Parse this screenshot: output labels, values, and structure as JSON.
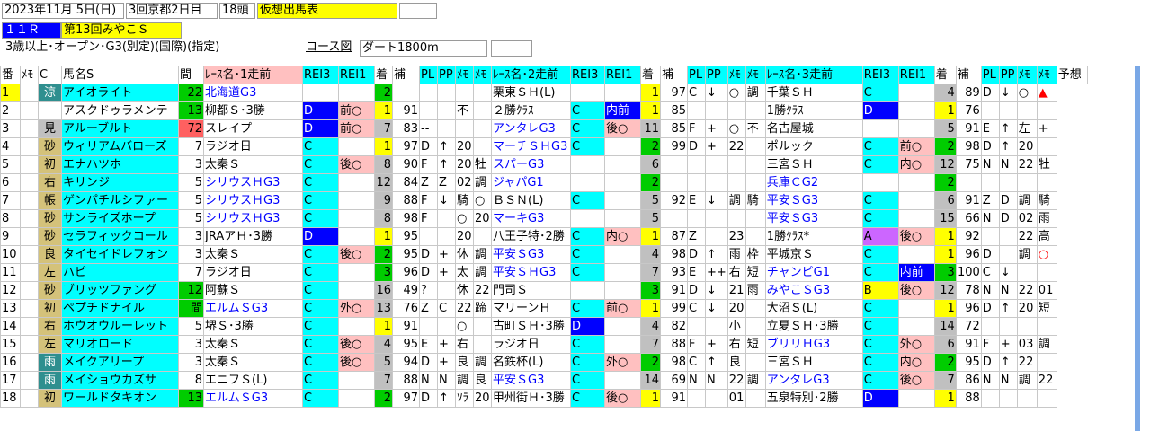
{
  "header": {
    "date": "2023年11月  5日(日)",
    "meeting": "3回京都2日目",
    "runners": "18頭",
    "sheet_title": "仮想出馬表",
    "race_no": "１１Ｒ",
    "race_name": "第13回みやこＳ",
    "conditions": "3歳以上･オープン･G3(別定)(国際)(指定)",
    "course_label": "コース図",
    "course": "ダート1800m"
  },
  "colors": {
    "yellow": "#ffff00",
    "cyan": "#00ffff",
    "blue": "#0000ff",
    "pink": "#ffc0c0",
    "gray": "#c0c0c0",
    "green": "#00cc00",
    "red_number": "#ff6060",
    "badge_gold": "#d4c27a",
    "badge_teal": "#2f8f8f",
    "text_blue": "#0000ff",
    "text_red": "#ff0000",
    "a_purple": "#cc66ff"
  },
  "columns": [
    "番",
    "ﾒﾓ",
    "C",
    "馬名S",
    "間",
    "ﾚｰｽ名･1走前",
    "REI3",
    "REI1",
    "着",
    "補",
    "PL",
    "PP",
    "ﾒﾓ",
    "ﾒﾓ",
    "ﾚｰｽ名･2走前",
    "REI3",
    "REI1",
    "着",
    "補",
    "PL",
    "PP",
    "ﾒﾓ",
    "ﾒﾓ",
    "ﾚｰｽ名･3走前",
    "REI3",
    "REI1",
    "着",
    "補",
    "PL",
    "PP",
    "ﾒﾓ",
    "ﾒﾓ",
    "予想"
  ],
  "rows": [
    [
      "1",
      "",
      "涼",
      "アイオライト",
      "22",
      "北海道G3",
      "",
      "",
      "2",
      "",
      "",
      "",
      "",
      "",
      "栗東ＳＨ(L)",
      "",
      "",
      "1",
      "97",
      "C",
      "↓",
      "○",
      "調",
      "千葉ＳＨ",
      "C",
      "",
      "4",
      "89",
      "D",
      "↓",
      "○",
      "▲"
    ],
    [
      "2",
      "",
      "",
      "アスクドゥラメンテ",
      "13",
      "柳都Ｓ･3勝",
      "D",
      "前○",
      "1",
      "91",
      "",
      "",
      "不",
      "",
      "２勝ｸﾗｽ",
      "C",
      "内前",
      "1",
      "85",
      "",
      "",
      "",
      "",
      "1勝ｸﾗｽ",
      "D",
      "",
      "1",
      "76",
      "",
      "",
      "",
      ""
    ],
    [
      "3",
      "",
      "見",
      "アルーブルト",
      "72",
      "スレイプ",
      "D",
      "前○",
      "7",
      "83",
      "--",
      "",
      "",
      "",
      "アンタレG3",
      "C",
      "後○",
      "11",
      "85",
      "F",
      "+",
      "○",
      "不",
      "名古屋城",
      "",
      "",
      "5",
      "91",
      "E",
      "↑",
      "左",
      "+"
    ],
    [
      "4",
      "",
      "砂",
      "ウィリアムバローズ",
      "7",
      "ラジオ日",
      "C",
      "",
      "1",
      "97",
      "D",
      "↑",
      "20",
      "",
      "マーチＳＨG3",
      "C",
      "",
      "2",
      "99",
      "D",
      "+",
      "22",
      "",
      "ポルック",
      "C",
      "前○",
      "2",
      "98",
      "D",
      "↑",
      "20",
      ""
    ],
    [
      "5",
      "",
      "初",
      "エナハツホ",
      "3",
      "太秦Ｓ",
      "C",
      "後○",
      "8",
      "90",
      "F",
      "↑",
      "20",
      "牡",
      "スパーG3",
      "",
      "",
      "6",
      "",
      "",
      "",
      "",
      "",
      "三宮ＳＨ",
      "C",
      "内○",
      "12",
      "75",
      "N",
      "N",
      "22",
      "牡"
    ],
    [
      "6",
      "",
      "右",
      "キリンジ",
      "5",
      "シリウスＨG3",
      "C",
      "",
      "12",
      "84",
      "Z",
      "Z",
      "02",
      "調",
      "ジャパG1",
      "",
      "",
      "2",
      "",
      "",
      "",
      "",
      "",
      "兵庫ＣG2",
      "",
      "",
      "2",
      "",
      "",
      "",
      "",
      ""
    ],
    [
      "7",
      "",
      "帳",
      "ゲンパチルシファー",
      "5",
      "シリウスＨG3",
      "C",
      "",
      "9",
      "88",
      "F",
      "↓",
      "騎",
      "○",
      "ＢＳＮ(L)",
      "C",
      "",
      "5",
      "92",
      "E",
      "↓",
      "調",
      "騎",
      "平安ＳG3",
      "C",
      "",
      "6",
      "91",
      "Z",
      "D",
      "調",
      "騎"
    ],
    [
      "8",
      "",
      "砂",
      "サンライズホープ",
      "5",
      "シリウスＨG3",
      "C",
      "",
      "8",
      "98",
      "F",
      "",
      "○",
      "20",
      "マーキG3",
      "",
      "",
      "5",
      "",
      "",
      "",
      "",
      "",
      "平安ＳG3",
      "C",
      "",
      "15",
      "66",
      "N",
      "D",
      "02",
      "雨"
    ],
    [
      "9",
      "",
      "砂",
      "セラフィックコール",
      "3",
      "JRAアＨ･3勝",
      "D",
      "",
      "1",
      "95",
      "",
      "",
      "20",
      "",
      "八王子特･2勝",
      "C",
      "内○",
      "1",
      "87",
      "Z",
      "",
      "23",
      "",
      "1勝ｸﾗｽ*",
      "A",
      "後○",
      "1",
      "92",
      "",
      "",
      "22",
      "高"
    ],
    [
      "10",
      "",
      "良",
      "タイセイドレフォン",
      "3",
      "太秦Ｓ",
      "C",
      "後○",
      "2",
      "95",
      "D",
      "+",
      "休",
      "調",
      "平安ＳG3",
      "C",
      "",
      "4",
      "98",
      "D",
      "↑",
      "雨",
      "枠",
      "平城京Ｓ",
      "C",
      "",
      "1",
      "96",
      "D",
      "",
      "調",
      "○"
    ],
    [
      "11",
      "",
      "左",
      "ハピ",
      "7",
      "ラジオ日",
      "C",
      "",
      "3",
      "96",
      "D",
      "+",
      "太",
      "調",
      "平安ＳＨG3",
      "C",
      "",
      "7",
      "93",
      "E",
      "++",
      "右",
      "短",
      "チャンピG1",
      "C",
      "内前",
      "3",
      "100",
      "C",
      "↓",
      "",
      ""
    ],
    [
      "12",
      "",
      "砂",
      "ブリッツファング",
      "12",
      "阿蘇Ｓ",
      "C",
      "",
      "16",
      "49",
      "?",
      "",
      "休",
      "22",
      "門司Ｓ",
      "",
      "",
      "3",
      "91",
      "D",
      "↓",
      "21",
      "雨",
      "みやこＳG3",
      "B",
      "後○",
      "12",
      "78",
      "N",
      "N",
      "22",
      "01"
    ],
    [
      "13",
      "",
      "初",
      "ペプチドナイル",
      "間",
      "エルムＳG3",
      "C",
      "外○",
      "13",
      "76",
      "Z",
      "C",
      "22",
      "蹄",
      "マリーンＨ",
      "C",
      "前○",
      "1",
      "99",
      "C",
      "↓",
      "20",
      "",
      "大沼Ｓ(L)",
      "C",
      "",
      "1",
      "96",
      "D",
      "↑",
      "20",
      "短"
    ],
    [
      "14",
      "",
      "右",
      "ホウオウルーレット",
      "5",
      "堺Ｓ･3勝",
      "C",
      "",
      "1",
      "91",
      "",
      "",
      "○",
      "",
      "古町ＳＨ･3勝",
      "D",
      "",
      "4",
      "82",
      "",
      "",
      "小",
      "",
      "立夏ＳＨ･3勝",
      "C",
      "",
      "14",
      "72",
      "",
      "",
      "",
      ""
    ],
    [
      "15",
      "",
      "左",
      "マリオロード",
      "3",
      "太秦Ｓ",
      "C",
      "後○",
      "4",
      "95",
      "E",
      "+",
      "右",
      "",
      "ラジオ日",
      "C",
      "",
      "7",
      "88",
      "F",
      "+",
      "右",
      "短",
      "ブリリＨG3",
      "C",
      "外○",
      "6",
      "91",
      "F",
      "+",
      "03",
      "調"
    ],
    [
      "16",
      "",
      "雨",
      "メイクアリープ",
      "3",
      "太秦Ｓ",
      "C",
      "後○",
      "5",
      "94",
      "D",
      "+",
      "良",
      "調",
      "名鉄杯(L)",
      "C",
      "外○",
      "2",
      "98",
      "C",
      "↑",
      "良",
      "",
      "三宮ＳＨ",
      "C",
      "内○",
      "2",
      "95",
      "D",
      "↑",
      "22",
      ""
    ],
    [
      "17",
      "",
      "雨",
      "メイショウカズサ",
      "8",
      "エニフＳ(L)",
      "C",
      "",
      "7",
      "88",
      "N",
      "N",
      "調",
      "良",
      "平安ＳG3",
      "C",
      "",
      "14",
      "69",
      "N",
      "N",
      "22",
      "調",
      "アンタレG3",
      "C",
      "後○",
      "7",
      "86",
      "N",
      "N",
      "調",
      "22"
    ],
    [
      "18",
      "",
      "初",
      "ワールドタキオン",
      "13",
      "エルムＳG3",
      "C",
      "",
      "2",
      "97",
      "D",
      "↑",
      "ｿﾗ",
      "20",
      "甲州街Ｈ･3勝",
      "C",
      "後○",
      "1",
      "91",
      "",
      "",
      "01",
      "",
      "五泉特別･2勝",
      "D",
      "",
      "1",
      "88",
      "",
      "",
      "",
      ""
    ]
  ]
}
